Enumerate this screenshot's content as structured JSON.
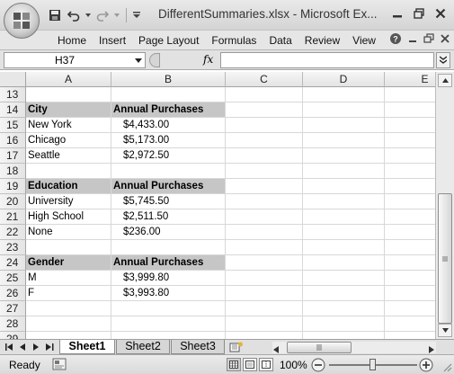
{
  "window": {
    "title": "DifferentSummaries.xlsx - Microsoft Ex..."
  },
  "quick_access": {
    "icons": [
      "save-icon",
      "undo-icon",
      "redo-icon",
      "customize-icon"
    ]
  },
  "ribbon": {
    "tabs": [
      "Home",
      "Insert",
      "Page Layout",
      "Formulas",
      "Data",
      "Review",
      "View"
    ]
  },
  "formula_bar": {
    "name_box": "H37",
    "fx_label": "fx",
    "formula": ""
  },
  "columns": [
    "A",
    "B",
    "C",
    "D",
    "E"
  ],
  "rows": [
    {
      "num": "13",
      "a": "",
      "b": "",
      "header": false
    },
    {
      "num": "14",
      "a": "City",
      "b": "Annual Purchases",
      "header": true
    },
    {
      "num": "15",
      "a": "New York",
      "b": "$4,433.00",
      "header": false
    },
    {
      "num": "16",
      "a": "Chicago",
      "b": "$5,173.00",
      "header": false
    },
    {
      "num": "17",
      "a": "Seattle",
      "b": "$2,972.50",
      "header": false
    },
    {
      "num": "18",
      "a": "",
      "b": "",
      "header": false
    },
    {
      "num": "19",
      "a": "Education",
      "b": "Annual Purchases",
      "header": true
    },
    {
      "num": "20",
      "a": "University",
      "b": "$5,745.50",
      "header": false
    },
    {
      "num": "21",
      "a": "High School",
      "b": "$2,511.50",
      "header": false
    },
    {
      "num": "22",
      "a": "None",
      "b": "$236.00",
      "header": false
    },
    {
      "num": "23",
      "a": "",
      "b": "",
      "header": false
    },
    {
      "num": "24",
      "a": "Gender",
      "b": "Annual Purchases",
      "header": true
    },
    {
      "num": "25",
      "a": "M",
      "b": "$3,999.80",
      "header": false
    },
    {
      "num": "26",
      "a": "F",
      "b": "$3,993.80",
      "header": false
    },
    {
      "num": "27",
      "a": "",
      "b": "",
      "header": false
    },
    {
      "num": "28",
      "a": "",
      "b": "",
      "header": false
    },
    {
      "num": "29",
      "a": "",
      "b": "",
      "header": false
    }
  ],
  "sheets": [
    {
      "name": "Sheet1",
      "active": true
    },
    {
      "name": "Sheet2",
      "active": false
    },
    {
      "name": "Sheet3",
      "active": false
    }
  ],
  "status": {
    "text": "Ready",
    "zoom": "100%"
  },
  "colors": {
    "header_fill": "#c6c6c6",
    "grid_line": "#d8d8d8"
  }
}
